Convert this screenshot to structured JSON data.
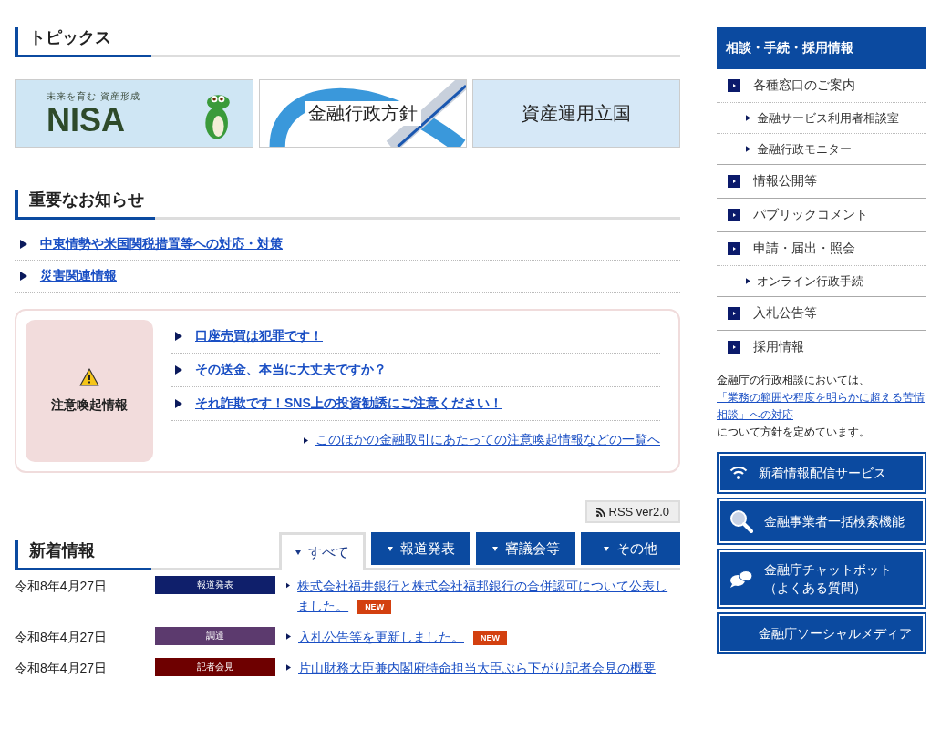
{
  "topics": {
    "title": "トピックス",
    "banners": [
      {
        "kind": "nisa",
        "subtitle": "未来を育む 資産形成",
        "label": "NISA"
      },
      {
        "kind": "swoosh",
        "label": "金融行政方針"
      },
      {
        "kind": "plain",
        "label": "資産運用立国"
      }
    ]
  },
  "notices": {
    "title": "重要なお知らせ",
    "links": [
      "中東情勢や米国関税措置等への対応・対策",
      "災害関連情報"
    ]
  },
  "alert": {
    "title": "注意喚起情報",
    "links": [
      "口座売買は犯罪です！",
      "その送金、本当に大丈夫ですか？",
      "それ詐欺です！SNS上の投資勧誘にご注意ください！"
    ],
    "more": "このほかの金融取引にあたっての注意喚起情報などの一覧へ"
  },
  "rss": "RSS ver2.0",
  "news": {
    "title": "新着情報",
    "tabs": [
      {
        "label": "すべて",
        "selected": true
      },
      {
        "label": "報道発表",
        "selected": false
      },
      {
        "label": "審議会等",
        "selected": false
      },
      {
        "label": "その他",
        "selected": false
      }
    ],
    "items": [
      {
        "date": "令和8年4月27日",
        "category": "報道発表",
        "color": "#0f1f6b",
        "title": "株式会社福井銀行と株式会社福邦銀行の合併認可について公表しました。",
        "badge": "NEW"
      },
      {
        "date": "令和8年4月27日",
        "category": "調達",
        "color": "#5c3a6e",
        "title": "入札公告等を更新しました。",
        "badge": "NEW"
      },
      {
        "date": "令和8年4月27日",
        "category": "記者会見",
        "color": "#6e0000",
        "title": "片山財務大臣兼内閣府特命担当大臣ぶら下がり記者会見の概要"
      }
    ]
  },
  "sidebar": {
    "title": "相談・手続・採用情報",
    "items": [
      {
        "label": "各種窓口のご案内",
        "children": [
          {
            "label": "金融サービス利用者相談室"
          },
          {
            "label": "金融行政モニター"
          }
        ]
      },
      {
        "label": "情報公開等"
      },
      {
        "label": "パブリックコメント"
      },
      {
        "label": "申請・届出・照会",
        "children": [
          {
            "label": "オンライン行政手続"
          }
        ]
      },
      {
        "label": "入札公告等"
      },
      {
        "label": "採用情報"
      }
    ],
    "note": {
      "before": "金融庁の行政相談においては、",
      "link": "「業務の範囲や程度を明らかに超える苦情相談」への対応",
      "after": "について方針を定めています。"
    }
  },
  "services": [
    {
      "kind": "wifi",
      "lines": [
        "新着情報配信サービス"
      ]
    },
    {
      "kind": "search",
      "lines": [
        "金融事業者一括検索機能"
      ]
    },
    {
      "kind": "chat",
      "lines": [
        "金融庁チャットボット",
        "（よくある質問）"
      ]
    },
    {
      "kind": "plain",
      "lines": [
        "金融庁ソーシャルメディア"
      ]
    }
  ]
}
